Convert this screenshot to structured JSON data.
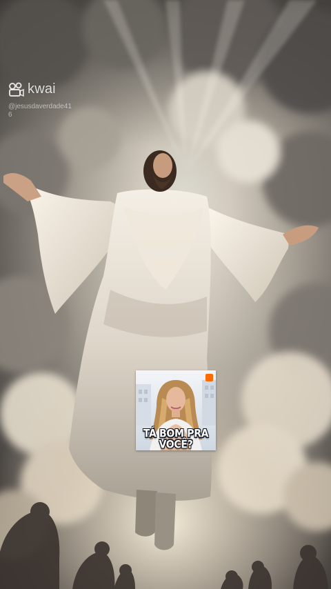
{
  "watermark": {
    "brand": "kwai",
    "handle": "@jesusdaverdade41",
    "suffix": "6",
    "logo_icon": "kwai-logo-icon"
  },
  "sticker": {
    "caption": "TÁ BOM PRA VOCÊ?",
    "badge_icon": "kwai-badge-icon",
    "badge_color": "#ff6a00"
  }
}
